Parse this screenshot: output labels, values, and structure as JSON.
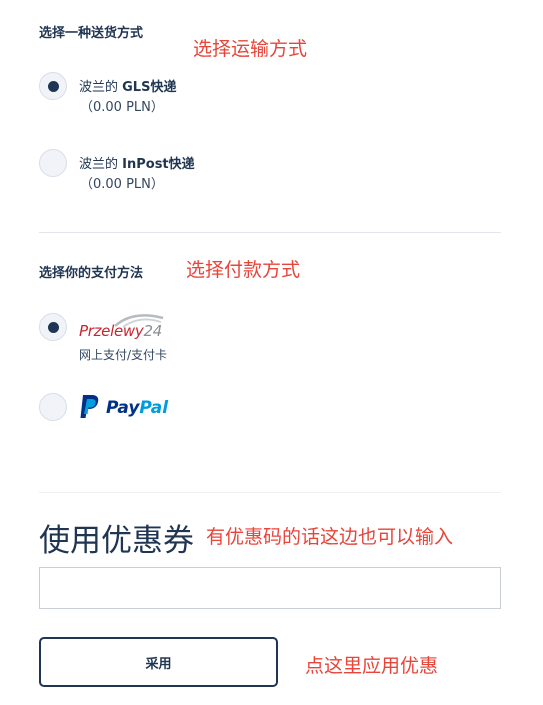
{
  "shipping": {
    "title": "选择一种送货方式",
    "annotation": "选择运输方式",
    "options": [
      {
        "prefix": "波兰的 ",
        "name": "GLS快递",
        "price": "（0.00 PLN）",
        "selected": true
      },
      {
        "prefix": "波兰的 ",
        "name": "InPost快递",
        "price": "（0.00 PLN）",
        "selected": false
      }
    ]
  },
  "payment": {
    "title": "选择你的支付方法",
    "annotation": "选择付款方式",
    "options": [
      {
        "logo_main": "Przelewy",
        "logo_num": "24",
        "caption": "网上支付/支付卡",
        "selected": true
      },
      {
        "logo_pay": "Pay",
        "logo_pal": "Pal",
        "selected": false
      }
    ]
  },
  "coupon": {
    "title": "使用优惠券",
    "annotation": "有优惠码的话这边也可以输入",
    "input_value": "",
    "input_placeholder": "",
    "apply_label": "采用",
    "apply_annotation": "点这里应用优惠"
  },
  "colors": {
    "primary": "#1f3552",
    "annotation": "#e8443a",
    "paypal_dark": "#003087",
    "paypal_light": "#009cde",
    "przelewy_red": "#c9252f"
  },
  "icons": {
    "paypal_logo": "paypal-logo-icon",
    "przelewy_logo": "przelewy24-logo-icon"
  }
}
